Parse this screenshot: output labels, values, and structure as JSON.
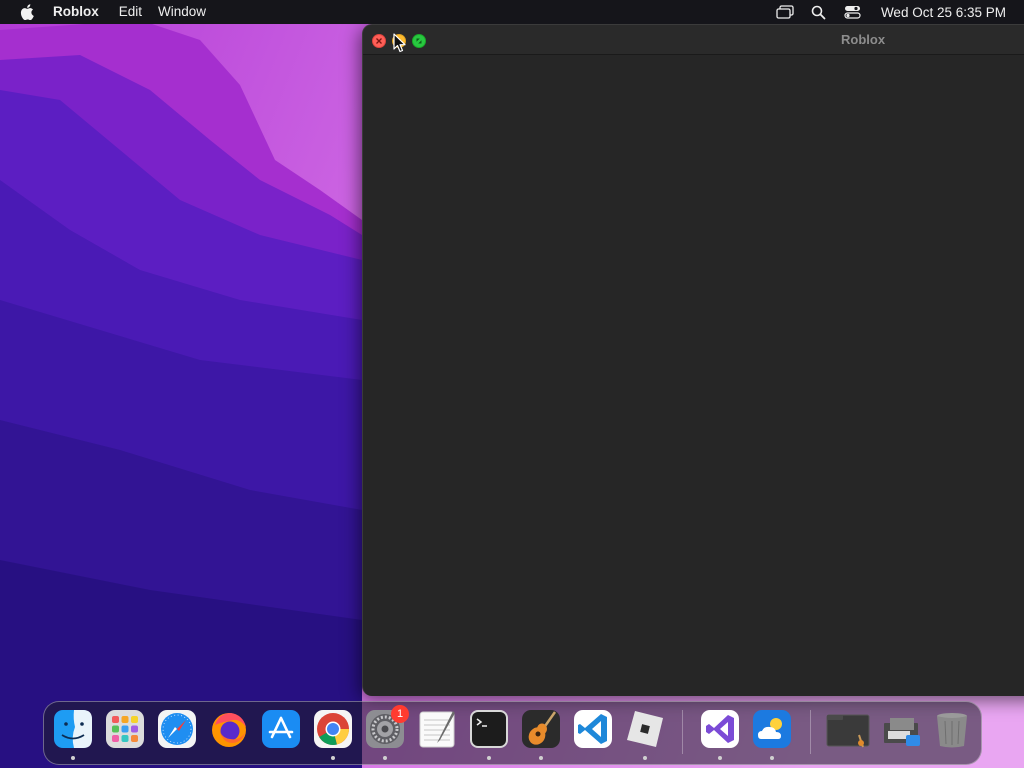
{
  "menubar": {
    "app_name": "Roblox",
    "menus": [
      "Edit",
      "Window"
    ],
    "icons": [
      "apple-icon",
      "screen-mirroring-icon",
      "spotlight-search-icon",
      "control-center-icon"
    ],
    "clock": "Wed Oct 25  6:35 PM"
  },
  "window": {
    "title": "Roblox",
    "background": "#262626"
  },
  "dock": {
    "items": [
      {
        "name": "Finder",
        "running": true
      },
      {
        "name": "Launchpad",
        "running": false
      },
      {
        "name": "Safari",
        "running": false
      },
      {
        "name": "Firefox",
        "running": false
      },
      {
        "name": "App Store",
        "running": false
      },
      {
        "name": "Google Chrome",
        "running": true
      },
      {
        "name": "System Preferences",
        "running": true,
        "badge": "1"
      },
      {
        "name": "TextEdit",
        "running": false
      },
      {
        "name": "Terminal",
        "running": true
      },
      {
        "name": "GarageBand",
        "running": true
      },
      {
        "name": "Visual Studio Code",
        "running": false
      },
      {
        "name": "Roblox",
        "running": true
      },
      {
        "name": "Visual Studio",
        "running": true
      },
      {
        "name": "Weather",
        "running": true
      },
      {
        "name": "Downloads Folder",
        "running": false
      },
      {
        "name": "Screenshot Folder",
        "running": false
      },
      {
        "name": "Trash",
        "running": false
      }
    ]
  },
  "colors": {
    "menubar": "#15151a",
    "close": "#ff5f57",
    "minimize": "#febc2e",
    "maximize": "#28c840",
    "badge": "#ff3b30"
  }
}
